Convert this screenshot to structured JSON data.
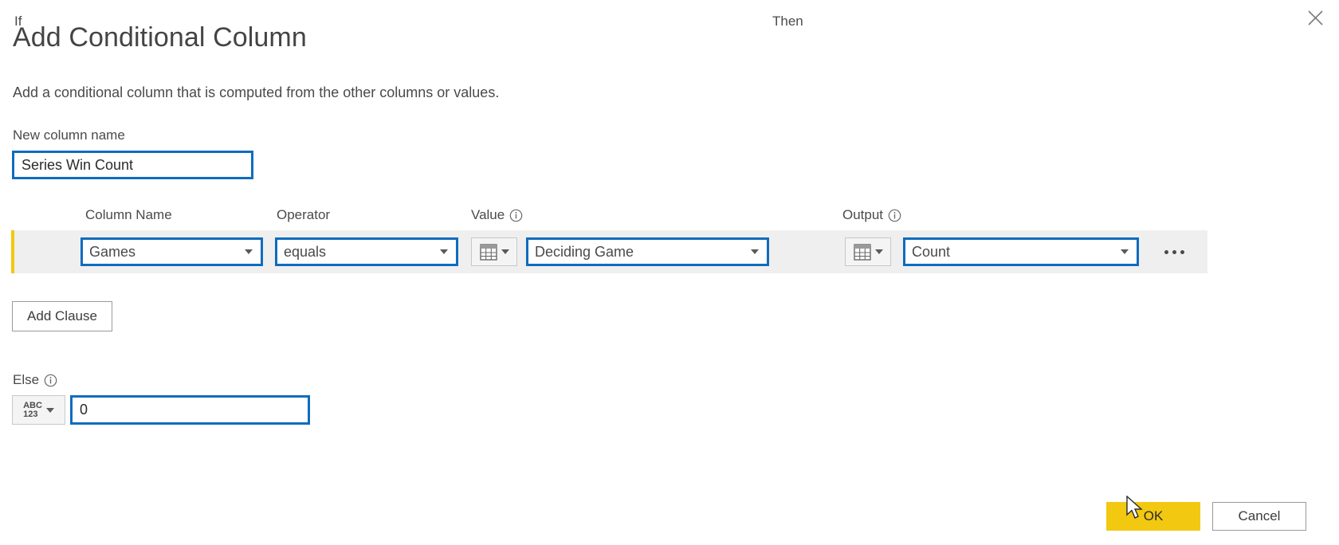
{
  "dialog": {
    "title": "Add Conditional Column",
    "subtitle": "Add a conditional column that is computed from the other columns or values.",
    "close_icon": "close-icon"
  },
  "new_column": {
    "label": "New column name",
    "value": "Series Win Count",
    "placeholder": ""
  },
  "headers": {
    "column_name": "Column Name",
    "operator": "Operator",
    "value": "Value",
    "output": "Output",
    "info_icon": "info-icon"
  },
  "clause": {
    "if_label": "If",
    "then_label": "Then",
    "column_name": "Games",
    "operator": "equals",
    "value": "Deciding Game",
    "output": "Count",
    "value_type_icon": "table-grid-icon",
    "output_type_icon": "table-grid-icon",
    "more_options": "ellipsis-icon",
    "accent_color": "#f2c811",
    "row_color": "#efefef"
  },
  "add_clause": {
    "label": "Add Clause"
  },
  "else": {
    "label": "Else",
    "type_icon_top": "ABC",
    "type_icon_bottom": "123",
    "value": "0",
    "info_icon": "info-icon"
  },
  "footer": {
    "ok_label": "OK",
    "cancel_label": "Cancel",
    "ok_color": "#f2c811"
  },
  "theme": {
    "focus_border": "#0f6cbd",
    "text": "#4a4a4a"
  }
}
